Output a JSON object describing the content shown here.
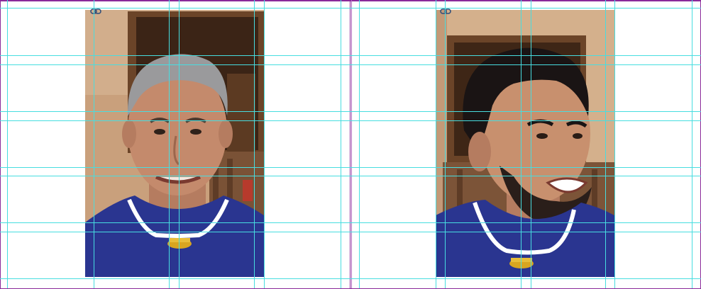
{
  "spread": {
    "pages": [
      {
        "photo": {
          "subject": "older-man-portrait"
        }
      },
      {
        "photo": {
          "subject": "young-man-portrait"
        }
      }
    ],
    "frame_color": "#8a2a9a",
    "guide_color": "#47dde0"
  },
  "icons": {
    "link_badge": "link-chain-icon"
  },
  "colors": {
    "shirt": "#2a3590",
    "wall": "#caa27e",
    "door": "#5a3a22",
    "skin": "#c48a6c",
    "gold": "#d9a520"
  }
}
